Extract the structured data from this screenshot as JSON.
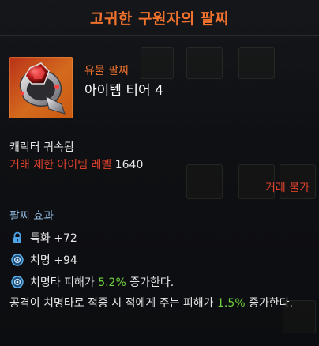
{
  "tooltip": {
    "title": "고귀한 구원자의 팔찌",
    "grade": "유물 팔찌",
    "tier": "아이템 티어 4",
    "bound": "캐릭터 귀속됨",
    "trade_limit_label": "거래 제한 아이템 레벨",
    "trade_limit_value": "1640",
    "trade_status": "거래 불가",
    "effects_header": "팔찌 효과",
    "stats": [
      {
        "text": "특화 +72",
        "icon": "lock-icon"
      },
      {
        "text": "치명 +94",
        "icon": "gem-icon"
      }
    ],
    "effect1": {
      "prefix": "치명타 피해가 ",
      "value": "5.2%",
      "suffix": " 증가한다.",
      "icon": "gem-icon"
    },
    "effect2": {
      "prefix": "공격이 치명타로 적중 시 적에게 주는 피해가 ",
      "value": "1.5%",
      "suffix": " 증가한다."
    }
  },
  "colors": {
    "title": "#f0722d",
    "red": "#e0412c",
    "header": "#8fb6dc",
    "green": "#6fd23c",
    "icon_bg": "#c95a12"
  }
}
